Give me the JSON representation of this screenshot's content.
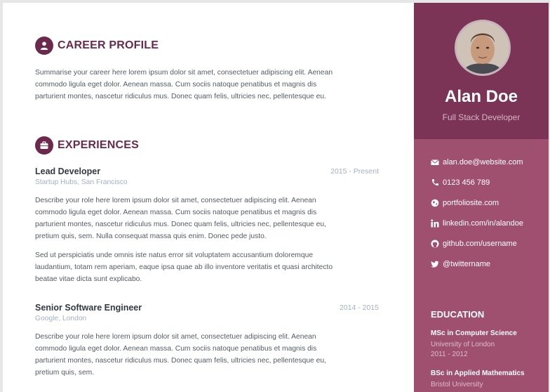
{
  "career": {
    "title": "CAREER PROFILE",
    "lines": [
      "Summarise your career here lorem ipsum dolor sit amet, consectetuer adipiscing elit. Aenean",
      "commodo ligula eget dolor. Aenean massa. Cum sociis natoque penatibus et magnis dis",
      "parturient montes, nascetur ridiculus mus. Donec quam felis, ultricies nec, pellentesque eu."
    ]
  },
  "experiences": {
    "title": "EXPERIENCES",
    "jobs": [
      {
        "title": "Lead Developer",
        "company": "Startup Hubs, San Francisco",
        "date": "2015 - Present",
        "p1": [
          "Describe your role here lorem ipsum dolor sit amet, consectetuer adipiscing elit. Aenean",
          "commodo ligula eget dolor. Aenean massa. Cum sociis natoque penatibus et magnis dis",
          "parturient montes, nascetur ridiculus mus. Donec quam felis, ultricies nec, pellentesque eu,",
          "pretium quis, sem. Nulla consequat massa quis enim. Donec pede justo."
        ],
        "p2": [
          "Sed ut perspiciatis unde omnis iste natus error sit voluptatem accusantium doloremque",
          "laudantium, totam rem aperiam, eaque ipsa quae ab illo inventore veritatis et quasi architecto",
          "beatae vitae dicta sunt explicabo."
        ]
      },
      {
        "title": "Senior Software Engineer",
        "company": "Google, London",
        "date": "2014 - 2015",
        "p1": [
          "Describe your role here lorem ipsum dolor sit amet, consectetuer adipiscing elit. Aenean",
          "commodo ligula eget dolor. Aenean massa. Cum sociis natoque penatibus et magnis dis",
          "parturient montes, nascetur ridiculus mus. Donec quam felis, ultricies nec, pellentesque eu,",
          "pretium quis, sem."
        ]
      }
    ]
  },
  "sidebar": {
    "name": "Alan Doe",
    "tagline": "Full Stack Developer",
    "contacts": {
      "email": "alan.doe@website.com",
      "phone": "0123 456 789",
      "website": "portfoliosite.com",
      "linkedin": "linkedin.com/in/alandoe",
      "github": "github.com/username",
      "twitter": "@twittername"
    },
    "education": {
      "title": "EDUCATION",
      "items": [
        {
          "degree": "MSc in Computer Science",
          "school": "University of London",
          "years": "2011 - 2012"
        },
        {
          "degree": "BSc in Applied Mathematics",
          "school": "Bristol University"
        }
      ]
    }
  },
  "colors": {
    "accent": "#6b2a4c",
    "sidebar_top": "#7b3456",
    "sidebar": "#a0506f"
  }
}
